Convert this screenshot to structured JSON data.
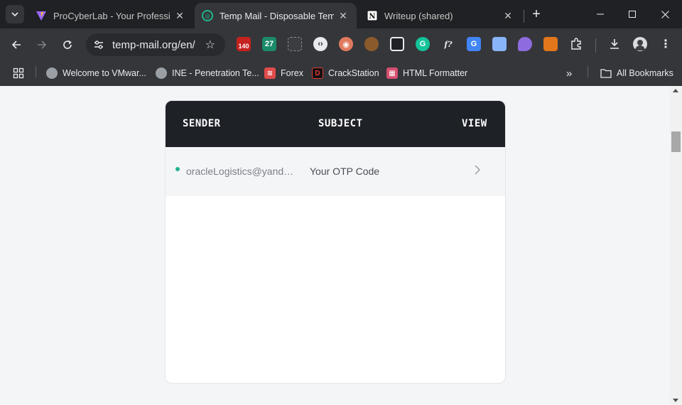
{
  "browser": {
    "tabs": [
      {
        "title": "ProCyberLab - Your Professional",
        "active": false
      },
      {
        "title": "Temp Mail - Disposable Temporary",
        "active": true
      },
      {
        "title": "Writeup (shared)",
        "active": false
      }
    ],
    "address_bar": {
      "url": "temp-mail.org/en/"
    },
    "extensions": [
      {
        "name": "calendar-badge-icon",
        "label": "140"
      },
      {
        "name": "extension-27-icon",
        "label": "27"
      },
      {
        "name": "cookie-icon",
        "label": ""
      },
      {
        "name": "grammarly-icon",
        "label": "G"
      },
      {
        "name": "formula-icon",
        "label": "f?"
      }
    ],
    "bookmarks": [
      {
        "label": "Welcome to VMwar..."
      },
      {
        "label": "INE - Penetration Te..."
      },
      {
        "label": "Forex"
      },
      {
        "label": "CrackStation"
      },
      {
        "label": "HTML Formatter"
      }
    ],
    "all_bookmarks_label": "All Bookmarks"
  },
  "inbox": {
    "columns": {
      "sender": "SENDER",
      "subject": "SUBJECT",
      "view": "VIEW"
    },
    "messages": [
      {
        "sender": "oracleLogistics@yandex.com",
        "subject": "Your OTP Code",
        "unread": true
      }
    ]
  },
  "colors": {
    "header_bg": "#1e2126",
    "unread_dot": "#21b58f",
    "page_bg": "#f4f5f7"
  }
}
